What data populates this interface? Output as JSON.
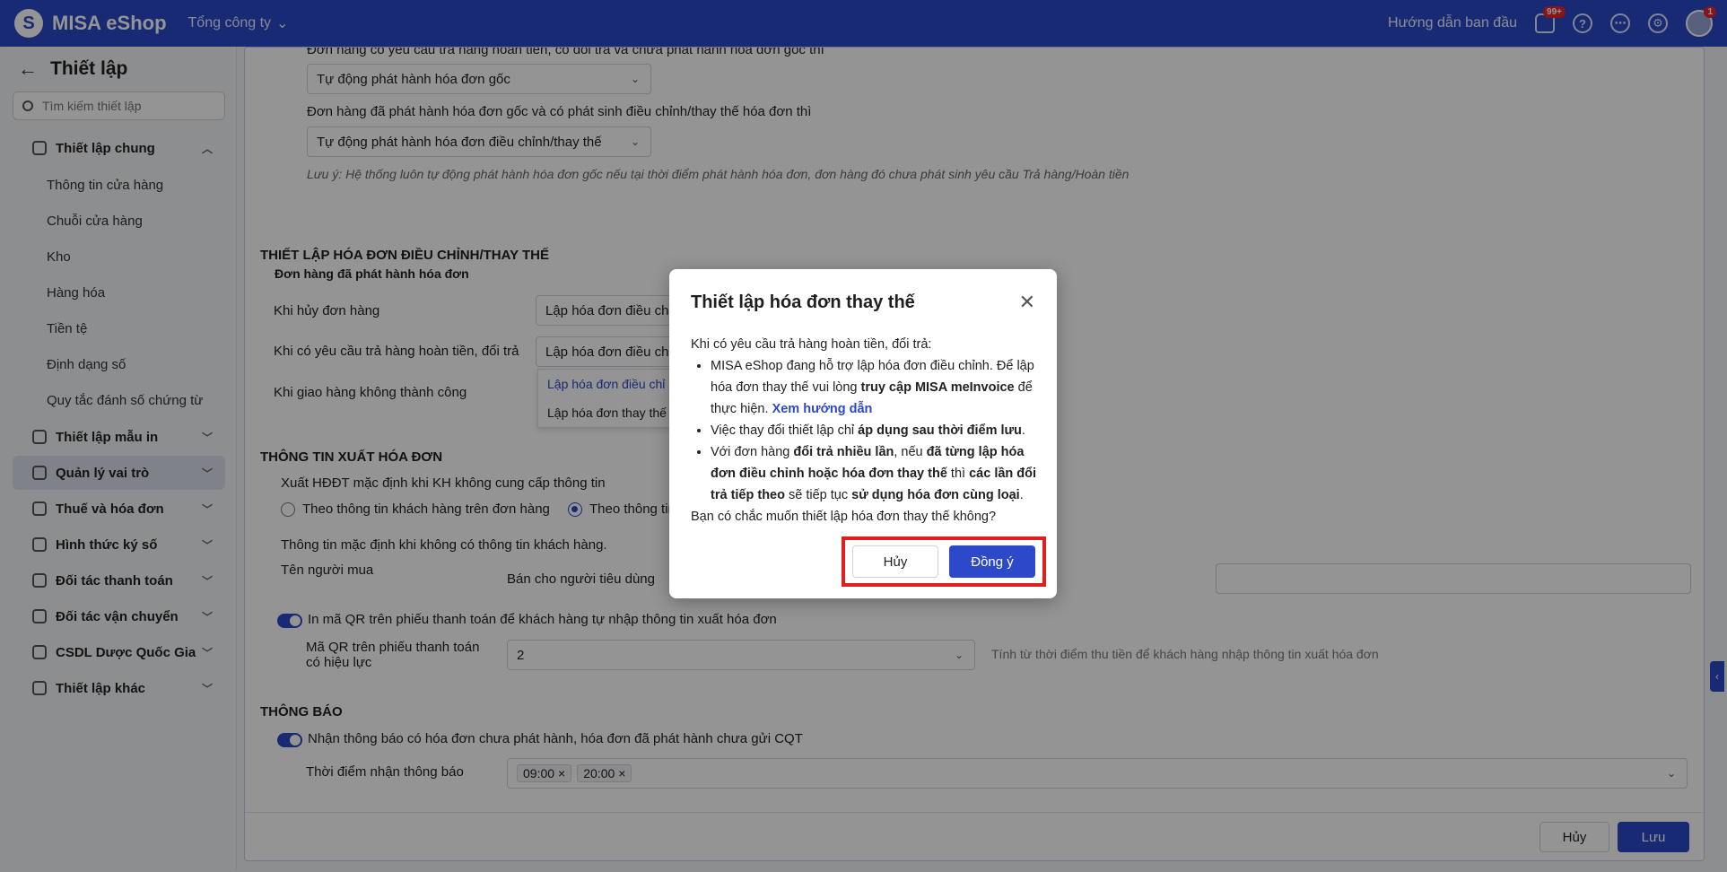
{
  "topbar": {
    "logo_text": "MISA eShop",
    "org_label": "Tổng công ty",
    "guide_label": "Hướng dẫn ban đầu",
    "notif_badge": "99+",
    "avatar_badge": "1"
  },
  "sidebar": {
    "title": "Thiết lập",
    "search_placeholder": "Tìm kiếm thiết lập",
    "groups": [
      {
        "label": "Thiết lập chung",
        "icon": "wrench-icon"
      },
      {
        "label": "Thiết lập mẫu in",
        "icon": "printer-icon"
      },
      {
        "label": "Quản lý vai trò",
        "icon": "user-role-icon"
      },
      {
        "label": "Thuế và hóa đơn",
        "icon": "invoice-icon"
      },
      {
        "label": "Hình thức ký số",
        "icon": "pen-icon"
      },
      {
        "label": "Đối tác thanh toán",
        "icon": "payment-icon"
      },
      {
        "label": "Đối tác vận chuyển",
        "icon": "truck-icon"
      },
      {
        "label": "CSDL Dược Quốc Gia",
        "icon": "link-icon"
      },
      {
        "label": "Thiết lập khác",
        "icon": "gear-icon"
      }
    ],
    "sub_items": [
      "Thông tin cửa hàng",
      "Chuỗi cửa hàng",
      "Kho",
      "Hàng hóa",
      "Tiền tệ",
      "Định dạng số",
      "Quy tắc đánh số chứng từ"
    ]
  },
  "content": {
    "q1": "Đơn hàng có yêu cầu trả hàng hoàn tiền, có đổi trả và chưa phát hành hóa đơn gốc thì",
    "sel1": "Tự động phát hành hóa đơn gốc",
    "q2": "Đơn hàng đã phát hành hóa đơn gốc và có phát sinh điều chỉnh/thay thế hóa đơn thì",
    "sel2": "Tự động phát hành hóa đơn điều chỉnh/thay thế",
    "note": "Lưu ý: Hệ thống luôn tự động phát hành hóa đơn gốc nếu tại thời điểm phát hành hóa đơn, đơn hàng đó chưa phát sinh yêu cầu Trả hàng/Hoàn tiền",
    "sec_adjust": "THIẾT LẬP HÓA ĐƠN ĐIỀU CHỈNH/THAY THẾ",
    "sub_issued": "Đơn hàng đã phát hành hóa đơn",
    "row_cancel": "Khi hủy đơn hàng",
    "row_return": "Khi có yêu cầu trả hàng hoàn tiền, đổi trả",
    "row_failed": "Khi giao hàng không thành công",
    "sel_adjust": "Lập hóa đơn điều chỉ",
    "opt_adjust": "Lập hóa đơn điều chỉ",
    "opt_replace": "Lập hóa đơn thay thế",
    "sec_export": "THÔNG TIN XUẤT HÓA ĐƠN",
    "export_q": "Xuất HĐĐT mặc định khi KH không cung cấp thông tin",
    "radio1": "Theo thông tin khách hàng trên đơn hàng",
    "radio2": "Theo thông tin",
    "default_info": "Thông tin mặc định khi không có thông tin khách hàng.",
    "buyer_label": "Tên người mua",
    "buyer_value": "Bán cho người tiêu dùng",
    "qr_toggle": "In mã QR trên phiếu thanh toán để khách hàng tự nhập thông tin xuất hóa đơn",
    "qr_valid_label": "Mã QR trên phiếu thanh toán có hiệu lực",
    "qr_valid_value": "2",
    "qr_hint": "Tính từ thời điểm thu tiền để khách hàng nhập thông tin xuất hóa đơn",
    "sec_notify": "THÔNG BÁO",
    "notify_toggle": "Nhận thông báo có hóa đơn chưa phát hành, hóa đơn đã phát hành chưa gửi CQT",
    "notify_time_label": "Thời điểm nhận thông báo",
    "times": [
      "09:00",
      "20:00"
    ],
    "cancel_btn": "Hủy",
    "save_btn": "Lưu"
  },
  "modal": {
    "title": "Thiết lập hóa đơn thay thế",
    "intro": "Khi có yêu cầu trả hàng hoàn tiền, đổi trả:",
    "b1_pre": "MISA eShop đang hỗ trợ lập hóa đơn điều chỉnh. Để lập hóa đơn thay thế vui lòng ",
    "b1_bold": "truy cập MISA meInvoice",
    "b1_mid": " để thực hiện. ",
    "b1_link": "Xem hướng dẫn",
    "b2_pre": "Việc thay đổi thiết lập chỉ ",
    "b2_bold": "áp dụng sau thời điểm lưu",
    "b2_end": ".",
    "b3_pre": "Với đơn hàng ",
    "b3_bold1": "đổi trả nhiều lần",
    "b3_mid1": ", nếu ",
    "b3_bold2": "đã từng lập hóa đơn điều chỉnh hoặc hóa đơn thay thế",
    "b3_mid2": " thì ",
    "b3_bold3": "các lần đổi trả tiếp theo",
    "b3_mid3": " sẽ tiếp tục ",
    "b3_bold4": "sử dụng hóa đơn cùng loại",
    "b3_end": ".",
    "question": "Bạn có chắc muốn thiết lập hóa đơn thay thế không?",
    "cancel": "Hủy",
    "ok": "Đồng ý"
  },
  "colors": {
    "primary": "#2b49c9",
    "highlight": "#e01e1e"
  }
}
